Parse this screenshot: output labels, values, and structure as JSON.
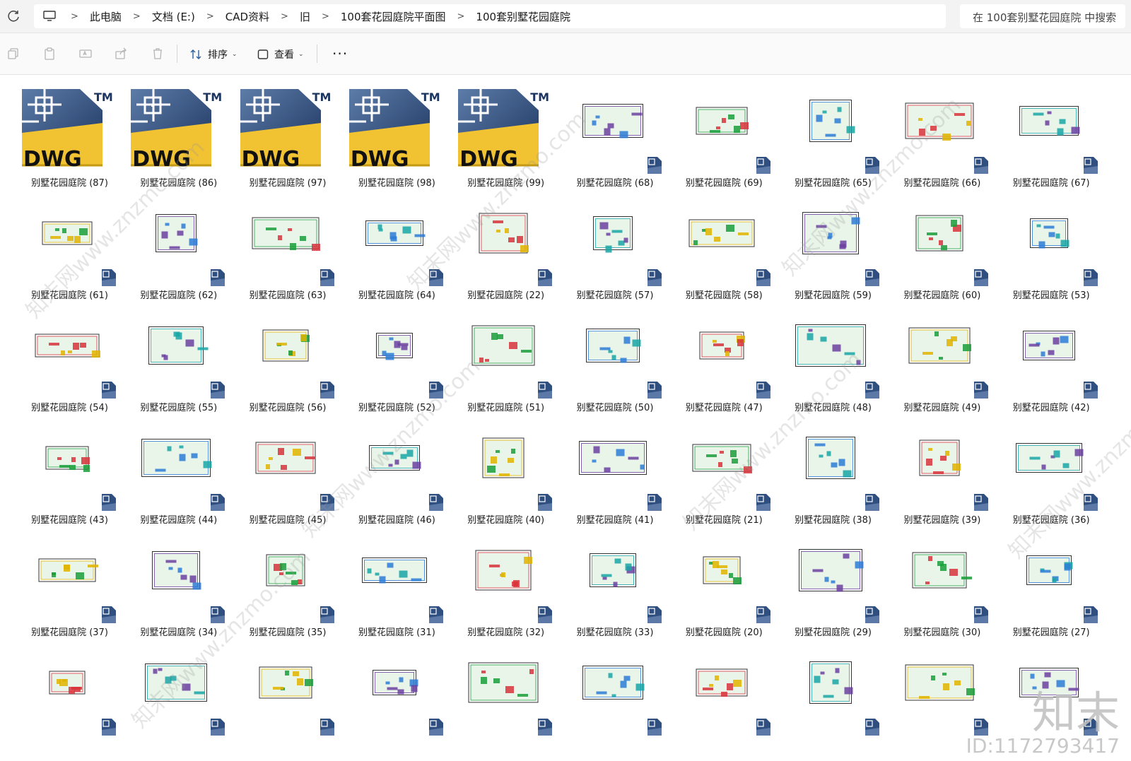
{
  "address": {
    "crumbs": [
      "此电脑",
      "文档 (E:)",
      "CAD资料",
      "旧",
      "100套花园庭院平面图",
      "100套别墅花园庭院"
    ],
    "search_placeholder": "在 100套别墅花园庭院 中搜索"
  },
  "toolbar": {
    "sort_label": "排序",
    "view_label": "查看",
    "more_label": "···"
  },
  "dwg_icon": {
    "text": "DWG",
    "tm": "TM"
  },
  "files": [
    {
      "name": "别墅花园庭院 (87)",
      "kind": "dwg"
    },
    {
      "name": "别墅花园庭院 (86)",
      "kind": "dwg"
    },
    {
      "name": "别墅花园庭院 (97)",
      "kind": "dwg"
    },
    {
      "name": "别墅花园庭院 (98)",
      "kind": "dwg"
    },
    {
      "name": "别墅花园庭院 (99)",
      "kind": "dwg"
    },
    {
      "name": "别墅花园庭院 (68)",
      "kind": "thumb"
    },
    {
      "name": "别墅花园庭院 (69)",
      "kind": "thumb"
    },
    {
      "name": "别墅花园庭院 (65)",
      "kind": "thumb"
    },
    {
      "name": "别墅花园庭院 (66)",
      "kind": "thumb"
    },
    {
      "name": "别墅花园庭院 (67)",
      "kind": "thumb"
    },
    {
      "name": "别墅花园庭院 (61)",
      "kind": "thumb"
    },
    {
      "name": "别墅花园庭院 (62)",
      "kind": "thumb"
    },
    {
      "name": "别墅花园庭院 (63)",
      "kind": "thumb"
    },
    {
      "name": "别墅花园庭院 (64)",
      "kind": "thumb"
    },
    {
      "name": "别墅花园庭院 (22)",
      "kind": "thumb"
    },
    {
      "name": "别墅花园庭院 (57)",
      "kind": "thumb"
    },
    {
      "name": "别墅花园庭院 (58)",
      "kind": "thumb"
    },
    {
      "name": "别墅花园庭院 (59)",
      "kind": "thumb"
    },
    {
      "name": "别墅花园庭院 (60)",
      "kind": "thumb"
    },
    {
      "name": "别墅花园庭院 (53)",
      "kind": "thumb"
    },
    {
      "name": "别墅花园庭院 (54)",
      "kind": "thumb"
    },
    {
      "name": "别墅花园庭院 (55)",
      "kind": "thumb"
    },
    {
      "name": "别墅花园庭院 (56)",
      "kind": "thumb"
    },
    {
      "name": "别墅花园庭院 (52)",
      "kind": "thumb"
    },
    {
      "name": "别墅花园庭院 (51)",
      "kind": "thumb"
    },
    {
      "name": "别墅花园庭院 (50)",
      "kind": "thumb"
    },
    {
      "name": "别墅花园庭院 (47)",
      "kind": "thumb"
    },
    {
      "name": "别墅花园庭院 (48)",
      "kind": "thumb"
    },
    {
      "name": "别墅花园庭院 (49)",
      "kind": "thumb"
    },
    {
      "name": "别墅花园庭院 (42)",
      "kind": "thumb"
    },
    {
      "name": "别墅花园庭院 (43)",
      "kind": "thumb"
    },
    {
      "name": "别墅花园庭院 (44)",
      "kind": "thumb"
    },
    {
      "name": "别墅花园庭院 (45)",
      "kind": "thumb"
    },
    {
      "name": "别墅花园庭院 (46)",
      "kind": "thumb"
    },
    {
      "name": "别墅花园庭院 (40)",
      "kind": "thumb"
    },
    {
      "name": "别墅花园庭院 (41)",
      "kind": "thumb"
    },
    {
      "name": "别墅花园庭院 (21)",
      "kind": "thumb"
    },
    {
      "name": "别墅花园庭院 (38)",
      "kind": "thumb"
    },
    {
      "name": "别墅花园庭院 (39)",
      "kind": "thumb"
    },
    {
      "name": "别墅花园庭院 (36)",
      "kind": "thumb"
    },
    {
      "name": "别墅花园庭院 (37)",
      "kind": "thumb"
    },
    {
      "name": "别墅花园庭院 (34)",
      "kind": "thumb"
    },
    {
      "name": "别墅花园庭院 (35)",
      "kind": "thumb"
    },
    {
      "name": "别墅花园庭院 (31)",
      "kind": "thumb"
    },
    {
      "name": "别墅花园庭院 (32)",
      "kind": "thumb"
    },
    {
      "name": "别墅花园庭院 (33)",
      "kind": "thumb"
    },
    {
      "name": "别墅花园庭院 (20)",
      "kind": "thumb"
    },
    {
      "name": "别墅花园庭院 (29)",
      "kind": "thumb"
    },
    {
      "name": "别墅花园庭院 (30)",
      "kind": "thumb"
    },
    {
      "name": "别墅花园庭院 (27)",
      "kind": "thumb"
    },
    {
      "name": "",
      "kind": "thumb"
    },
    {
      "name": "",
      "kind": "thumb"
    },
    {
      "name": "",
      "kind": "thumb"
    },
    {
      "name": "",
      "kind": "thumb"
    },
    {
      "name": "",
      "kind": "thumb"
    },
    {
      "name": "",
      "kind": "thumb"
    },
    {
      "name": "",
      "kind": "thumb"
    },
    {
      "name": "",
      "kind": "thumb"
    },
    {
      "name": "",
      "kind": "thumb"
    },
    {
      "name": "",
      "kind": "thumb"
    }
  ],
  "watermark": {
    "text": "知末网www.znzmo.com",
    "brand": "知末",
    "id": "ID:1172793417"
  }
}
